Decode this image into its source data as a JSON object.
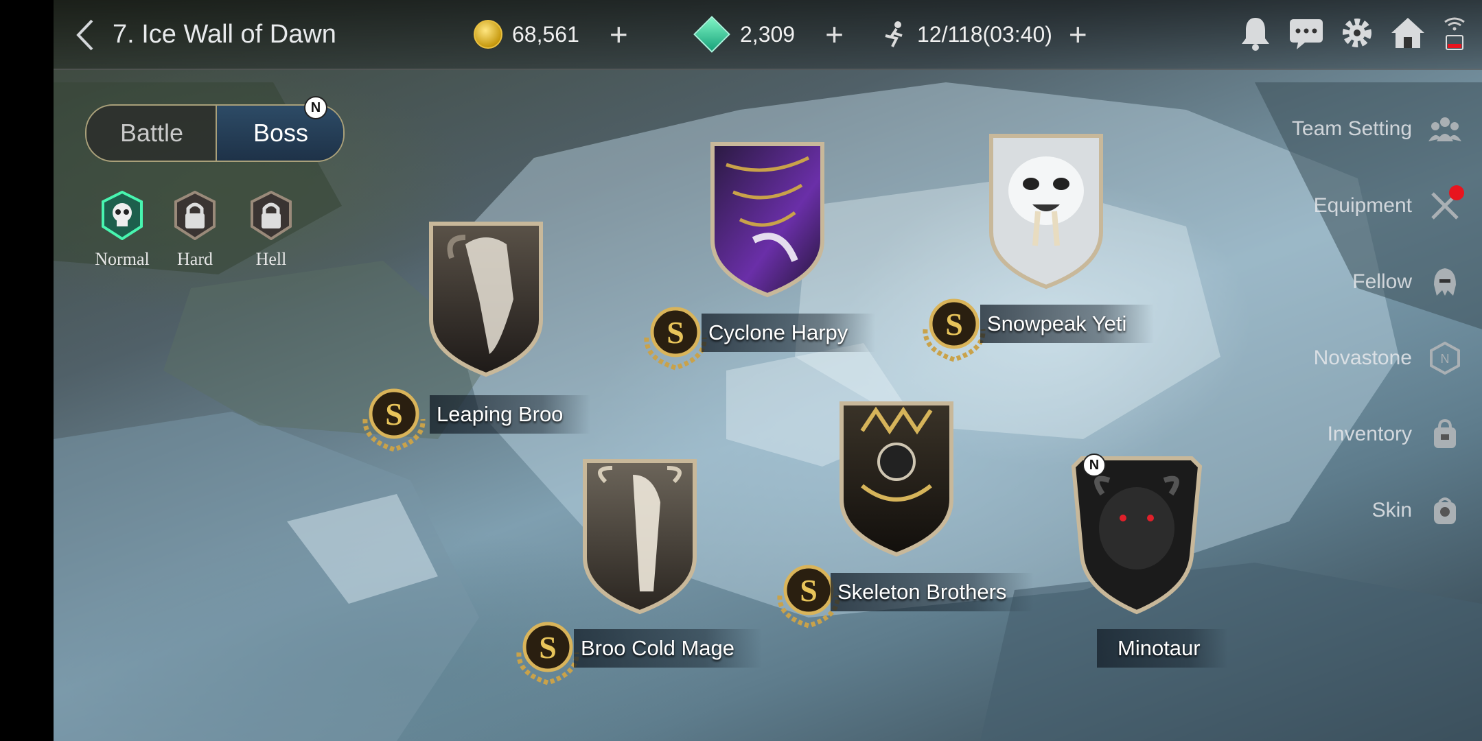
{
  "header": {
    "back_icon": "chevron-left-icon",
    "title": "7. Ice Wall of Dawn",
    "gold": "68,561",
    "gems": "2,309",
    "stamina": "12/118(03:40)",
    "icons": [
      "bell-icon",
      "chat-icon",
      "gear-icon",
      "home-icon"
    ],
    "status_icons": [
      "wifi-icon",
      "battery-icon"
    ]
  },
  "mode_toggle": {
    "battle_label": "Battle",
    "boss_label": "Boss",
    "new_badge": "N",
    "selected": "Boss"
  },
  "difficulty": [
    {
      "label": "Normal",
      "icon": "skull-icon",
      "locked": false
    },
    {
      "label": "Hard",
      "icon": "lock-icon",
      "locked": true
    },
    {
      "label": "Hell",
      "icon": "lock-icon",
      "locked": true
    }
  ],
  "side_menu": [
    {
      "label": "Team Setting",
      "icon": "team-icon"
    },
    {
      "label": "Equipment",
      "icon": "swords-icon",
      "alert": true
    },
    {
      "label": "Fellow",
      "icon": "helmet-icon"
    },
    {
      "label": "Novastone",
      "icon": "novastone-icon"
    },
    {
      "label": "Inventory",
      "icon": "bag-icon"
    },
    {
      "label": "Skin",
      "icon": "skin-icon"
    }
  ],
  "bosses": [
    {
      "name": "Leaping Broo",
      "rank": "S"
    },
    {
      "name": "Cyclone Harpy",
      "rank": "S"
    },
    {
      "name": "Snowpeak Yeti",
      "rank": "S"
    },
    {
      "name": "Broo Cold Mage",
      "rank": "S"
    },
    {
      "name": "Skeleton Brothers",
      "rank": "S"
    },
    {
      "name": "Minotaur",
      "rank": "",
      "new_badge": "N"
    }
  ],
  "colors": {
    "accent_gold": "#c9a24a",
    "toggle_active": "#1e3248",
    "alert_red": "#e8141e"
  }
}
